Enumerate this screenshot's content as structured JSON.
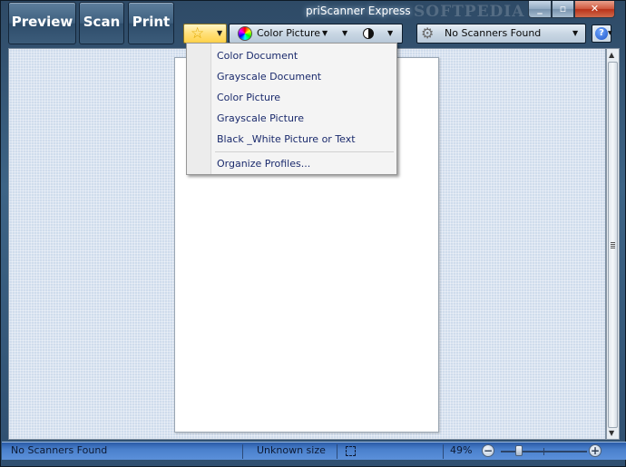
{
  "window": {
    "title": "priScanner Express",
    "watermark": "SOFTPEDIA",
    "minimize_glyph": "_",
    "maximize_glyph": "▫",
    "close_glyph": "✕"
  },
  "toolbar": {
    "preview_label": "Preview",
    "scan_label": "Scan",
    "print_label": "Print",
    "favorite_icon": "star-icon",
    "profile_label": "Color Picture",
    "scanner_label": "No Scanners Found",
    "help_glyph": "?"
  },
  "profile_menu": {
    "items": [
      "Color Document",
      "Grayscale Document",
      "Color Picture",
      "Grayscale Picture",
      "Black _White Picture or Text"
    ],
    "organize_label": "Organize Profiles..."
  },
  "statusbar": {
    "scanner_status": "No Scanners Found",
    "size_status": "Unknown size",
    "zoom_level": "49%",
    "zoom_out_glyph": "−",
    "zoom_in_glyph": "+"
  },
  "colors": {
    "frame": "#3d6486",
    "workspace": "#cfdcec",
    "statusbar": "#4a80cc",
    "menu_text": "#1a2a6c"
  }
}
